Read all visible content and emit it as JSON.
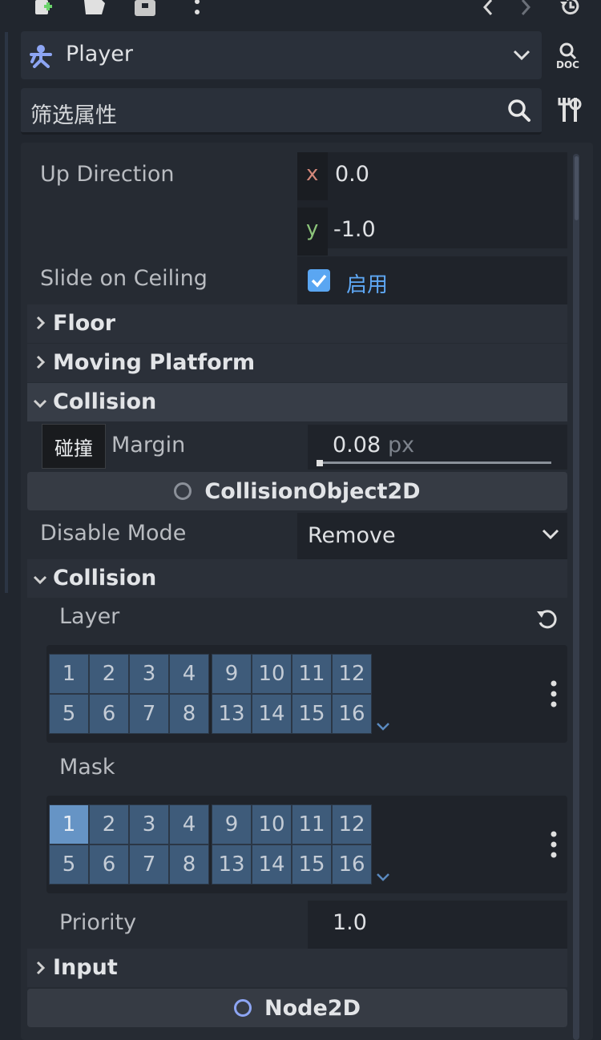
{
  "toolbar": {
    "icons": [
      "new-script-icon",
      "open-folder-icon",
      "save-icon",
      "more-vert-icon",
      "history-back-icon",
      "history-forward-icon",
      "history-list-icon"
    ]
  },
  "node_selector": {
    "name": "Player",
    "doc_label": "DOC"
  },
  "filter": {
    "placeholder": "筛选属性"
  },
  "properties": {
    "up_direction": {
      "label": "Up Direction",
      "x_axis": "x",
      "x": "0.0",
      "y_axis": "y",
      "y": "-1.0"
    },
    "slide_on_ceiling": {
      "label": "Slide on Ceiling",
      "checked": true,
      "value_text": "启用"
    }
  },
  "sections": {
    "floor": "Floor",
    "moving_platform": "Moving Platform",
    "collision": "Collision",
    "collision2": "Collision",
    "input": "Input"
  },
  "safe_margin": {
    "label": "Margin",
    "value": "0.08",
    "unit": "px",
    "slider_fraction": 0.0
  },
  "tooltip": {
    "text": "碰撞"
  },
  "categories": {
    "collision_object": "CollisionObject2D",
    "node2d": "Node2D"
  },
  "disable_mode": {
    "label": "Disable Mode",
    "value": "Remove"
  },
  "layer": {
    "label": "Layer",
    "group1": [
      "1",
      "2",
      "3",
      "4",
      "5",
      "6",
      "7",
      "8"
    ],
    "group2": [
      "9",
      "10",
      "11",
      "12",
      "13",
      "14",
      "15",
      "16"
    ],
    "enabled": []
  },
  "mask": {
    "label": "Mask",
    "group1": [
      "1",
      "2",
      "3",
      "4",
      "5",
      "6",
      "7",
      "8"
    ],
    "group2": [
      "9",
      "10",
      "11",
      "12",
      "13",
      "14",
      "15",
      "16"
    ],
    "enabled": [
      "1"
    ]
  },
  "priority": {
    "label": "Priority",
    "value": "1.0"
  },
  "colors": {
    "x_axis": "#d3877a",
    "y_axis": "#8cc47a",
    "checkbox": "#5aa6f2",
    "enabled_text": "#5ea8f5",
    "node2d_icon": "#8da5f3",
    "layer_cell": "#3e5b7a",
    "layer_cell_on": "#6694c5"
  }
}
